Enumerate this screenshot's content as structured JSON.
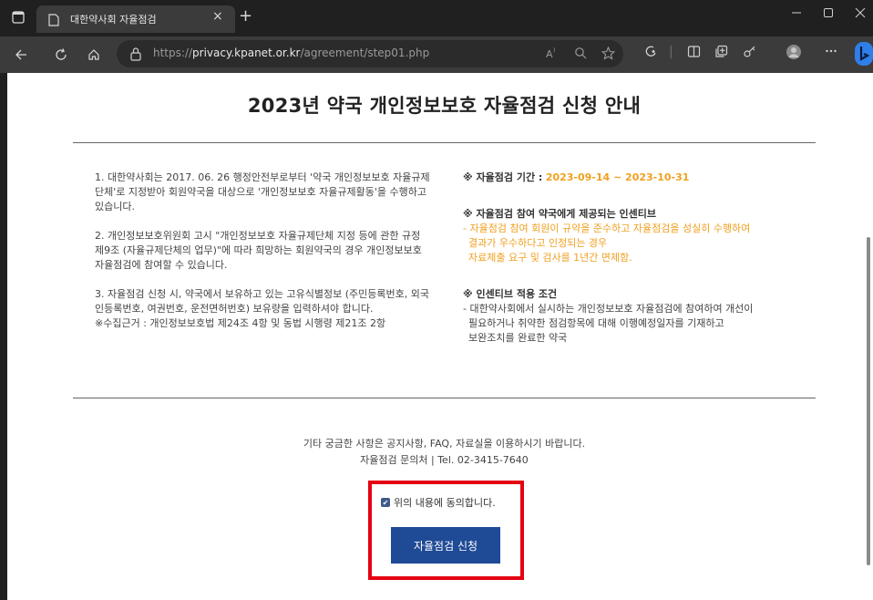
{
  "browser": {
    "tab_title": "대한약사회 자율점검",
    "tab_close": "×",
    "new_tab": "+",
    "url_prefix": "https://",
    "url_domain": "privacy.kpanet.or.kr",
    "url_path": "/agreement/step01.php",
    "icons": [
      "window-icon",
      "page-icon",
      "back-icon",
      "refresh-icon",
      "home-icon",
      "lock-icon",
      "read-aloud-icon",
      "zoom-icon",
      "favorite-icon",
      "extensions-icon",
      "split-screen-icon",
      "collections-icon",
      "settings-icon",
      "profile-icon",
      "more-icon",
      "bing-icon"
    ]
  },
  "page": {
    "title": "2023년 약국 개인정보보호 자율점검 신청 안내",
    "left": {
      "p1": "1. 대한약사회는 2017. 06. 26 행정안전부로부터 '약국 개인정보보호 자율규제단체'로 지정받아 회원약국을 대상으로 '개인정보보호 자율규제활동'을 수행하고 있습니다.",
      "p2": "2. 개인정보보호위원회 고시 \"개인정보보호 자율규제단체 지정 등에 관한 규정 제9조 (자율규제단체의 업무)\"에 따라 희망하는 회원약국의 경우 개인정보보호 자율점검에 참여할 수 있습니다.",
      "p3": "3. 자율점검 신청 시, 약국에서 보유하고 있는 고유식별정보 (주민등록번호, 외국인등록번호, 여권번호, 운전면허번호) 보유량을 입력하셔야 합니다.",
      "p3_note": "※수집근거 : 개인정보보호법 제24조 4항 및 동법 시행령 제21조 2항"
    },
    "right": {
      "period_label": "※ 자율점검 기간 :",
      "period_value": "2023-09-14 ~ 2023-10-31",
      "incentive_title": "※ 자율점검 참여 약국에게 제공되는 인센티브",
      "incentive_line1": "- 자율점검 참여 회원이 규약을 준수하고 자율점검을 성실히 수행하여",
      "incentive_line2": "결과가 우수하다고 인정되는 경우",
      "incentive_line3": "자료제출 요구 및 검사를 1년간 면제함.",
      "condition_title": "※ 인센티브 적용 조건",
      "condition_line1": "- 대한약사회에서 실시하는 개인정보보호 자율점검에 참여하여 개선이",
      "condition_line2": "필요하거나 취약한 점검항목에 대해 이행예정일자를 기재하고",
      "condition_line3": "보완조치를 완료한 약국"
    },
    "footer_line1": "기타 궁금한 사항은 공지사항, FAQ, 자료실을 이용하시기 바랍니다.",
    "footer_line2": "자율점검 문의처  |  Tel. 02-3415-7640",
    "agree_label": "위의 내용에 동의합니다.",
    "agree_checked": true,
    "apply_button": "자율점검 신청"
  },
  "colors": {
    "accent_orange": "#f0a020",
    "button_blue": "#1f4a96",
    "highlight_red": "#e50012"
  }
}
